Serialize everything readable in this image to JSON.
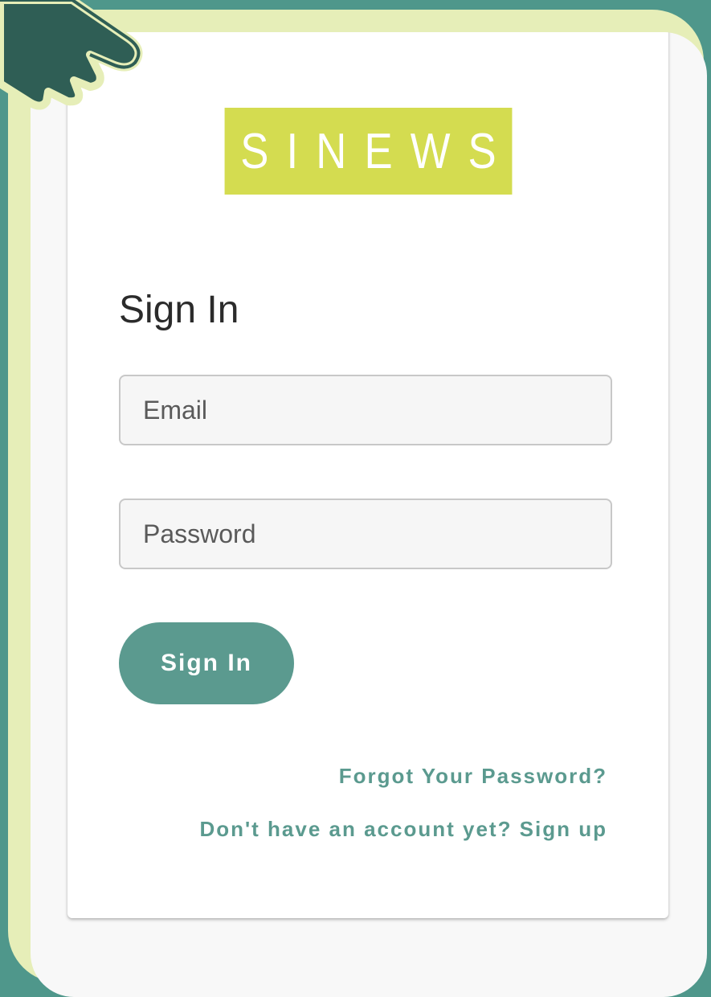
{
  "logo": {
    "text": "SINEWS"
  },
  "signin": {
    "heading": "Sign In",
    "email_placeholder": "Email",
    "password_placeholder": "Password",
    "button_label": "Sign In",
    "forgot_link": "Forgot Your Password?",
    "signup_link": "Don't have an account yet? Sign up"
  },
  "colors": {
    "background": "#4f978b",
    "frame": "#e6eeb8",
    "logo_bg": "#d4dc50",
    "accent": "#5b9a8f"
  },
  "icons": [
    "hand-pointer-icon"
  ]
}
